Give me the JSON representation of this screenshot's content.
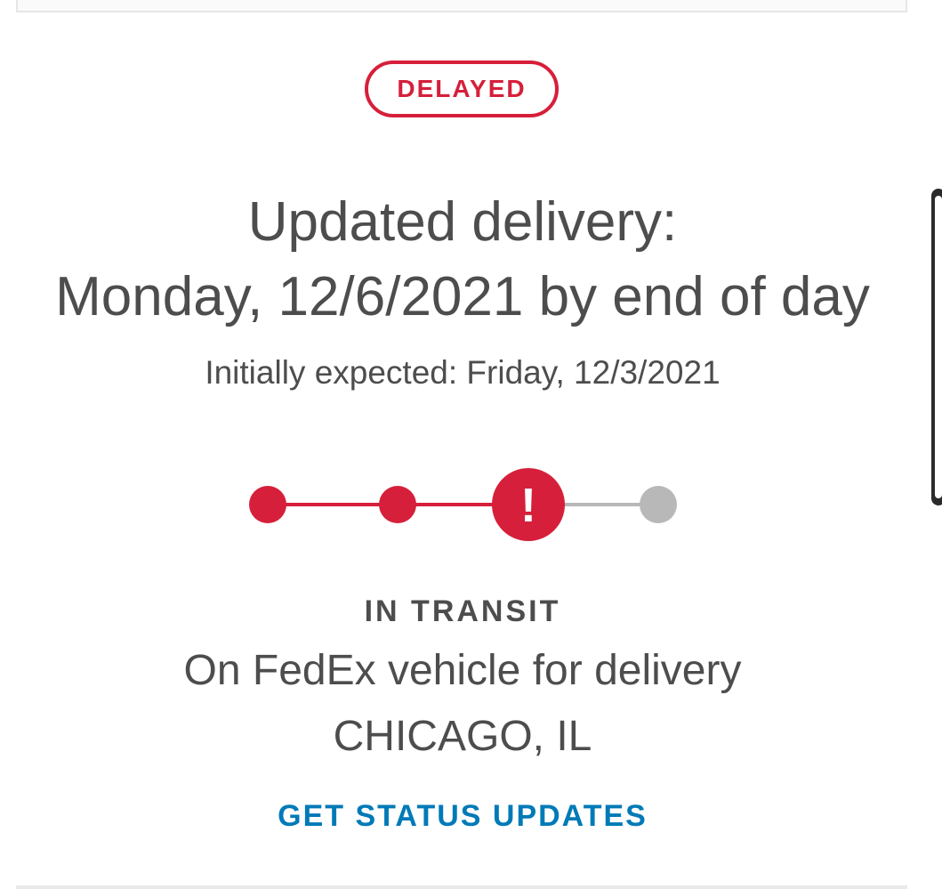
{
  "status_badge": "DELAYED",
  "delivery": {
    "headline_line1": "Updated delivery:",
    "headline_line2": "Monday, 12/6/2021 by end of day",
    "initially_expected": "Initially expected: Friday, 12/3/2021"
  },
  "progress": {
    "steps": 4,
    "current_step": 3,
    "current_icon": "exclamation-icon",
    "alert_glyph": "!"
  },
  "status": {
    "label": "IN TRANSIT",
    "description": "On FedEx vehicle for delivery",
    "location": "CHICAGO, IL"
  },
  "cta": {
    "label": "GET STATUS UPDATES"
  },
  "colors": {
    "accent_red": "#d61f3a",
    "link_blue": "#007ab7",
    "inactive_gray": "#b8b8b8",
    "text_gray": "#4d4d4d"
  }
}
